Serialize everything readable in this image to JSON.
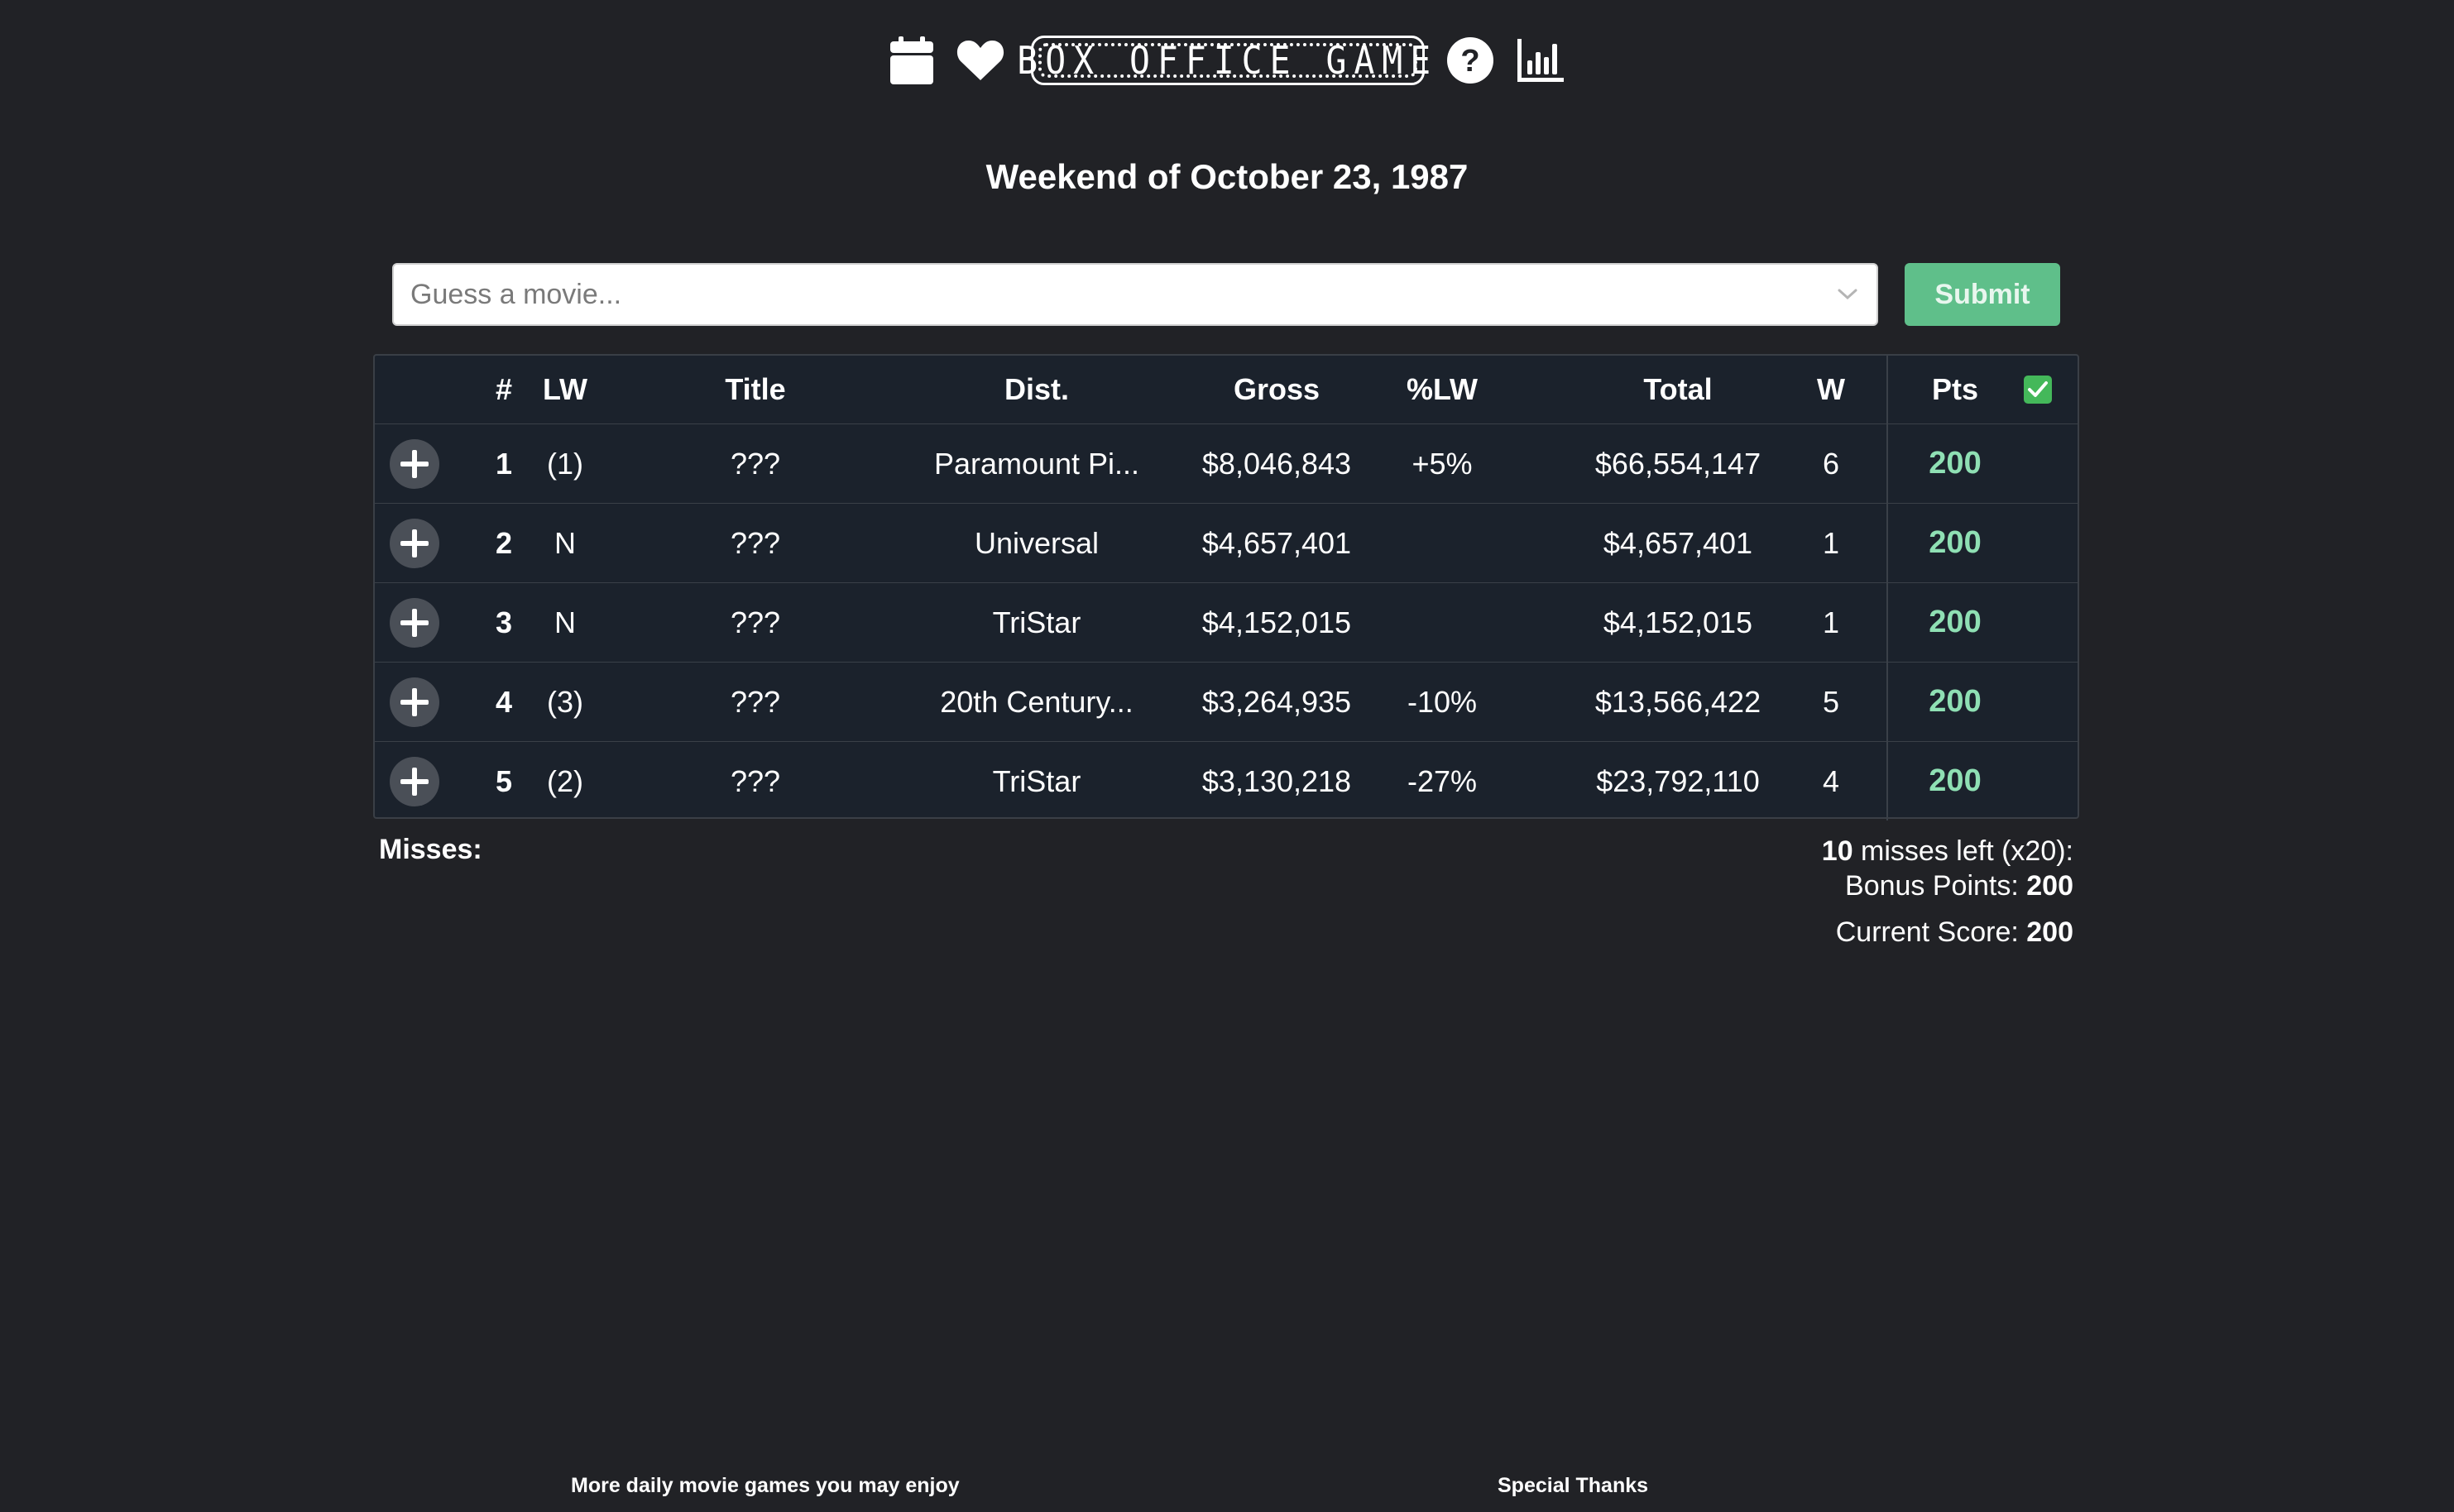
{
  "header": {
    "logo_text": "BOX OFFICE GAME",
    "icons": [
      "calendar-icon",
      "heart-icon",
      "help-icon",
      "stats-icon"
    ]
  },
  "week_title": "Weekend of October 23, 1987",
  "search": {
    "placeholder": "Guess a movie...",
    "submit_label": "Submit"
  },
  "table": {
    "headers": {
      "num": "#",
      "lw": "LW",
      "title": "Title",
      "dist": "Dist.",
      "gross": "Gross",
      "pct": "%LW",
      "total": "Total",
      "w": "W",
      "pts": "Pts",
      "check": "✓"
    },
    "rows": [
      {
        "num": "1",
        "lw": "(1)",
        "title": "???",
        "dist": "Paramount Pi...",
        "gross": "$8,046,843",
        "pct": "+5%",
        "total": "$66,554,147",
        "w": "6",
        "pts": "200"
      },
      {
        "num": "2",
        "lw": "N",
        "title": "???",
        "dist": "Universal",
        "gross": "$4,657,401",
        "pct": "",
        "total": "$4,657,401",
        "w": "1",
        "pts": "200"
      },
      {
        "num": "3",
        "lw": "N",
        "title": "???",
        "dist": "TriStar",
        "gross": "$4,152,015",
        "pct": "",
        "total": "$4,152,015",
        "w": "1",
        "pts": "200"
      },
      {
        "num": "4",
        "lw": "(3)",
        "title": "???",
        "dist": "20th Century...",
        "gross": "$3,264,935",
        "pct": "-10%",
        "total": "$13,566,422",
        "w": "5",
        "pts": "200"
      },
      {
        "num": "5",
        "lw": "(2)",
        "title": "???",
        "dist": "TriStar",
        "gross": "$3,130,218",
        "pct": "-27%",
        "total": "$23,792,110",
        "w": "4",
        "pts": "200"
      }
    ]
  },
  "summary": {
    "misses_label": "Misses:",
    "misses_left_count": "10",
    "misses_left_text": " misses left (x20):",
    "bonus_label": "Bonus Points: ",
    "bonus_value": "200",
    "score_label": "Current Score: ",
    "score_value": "200"
  },
  "footer": {
    "more_games": "More daily movie games you may enjoy",
    "special_thanks": "Special Thanks"
  },
  "colors": {
    "background": "#212226",
    "table_bg": "#1b222c",
    "points": "#8fe0b4",
    "submit": "#5fbf8a",
    "check": "#44b85a"
  }
}
